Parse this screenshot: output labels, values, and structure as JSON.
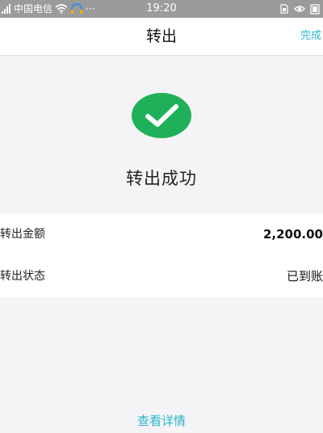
{
  "status_bar": {
    "carrier": "中国电信",
    "time": "19:20",
    "more": "···"
  },
  "nav": {
    "title": "转出",
    "done_label": "完成"
  },
  "result": {
    "message": "转出成功",
    "accent_color": "#1fb15a",
    "icon": "checkmark-icon"
  },
  "details": [
    {
      "label": "转出金额",
      "value": "2,200.00"
    },
    {
      "label": "转出状态",
      "value": "已到账"
    }
  ],
  "footer": {
    "link_label": "查看详情",
    "link_color": "#2ab6c9"
  }
}
